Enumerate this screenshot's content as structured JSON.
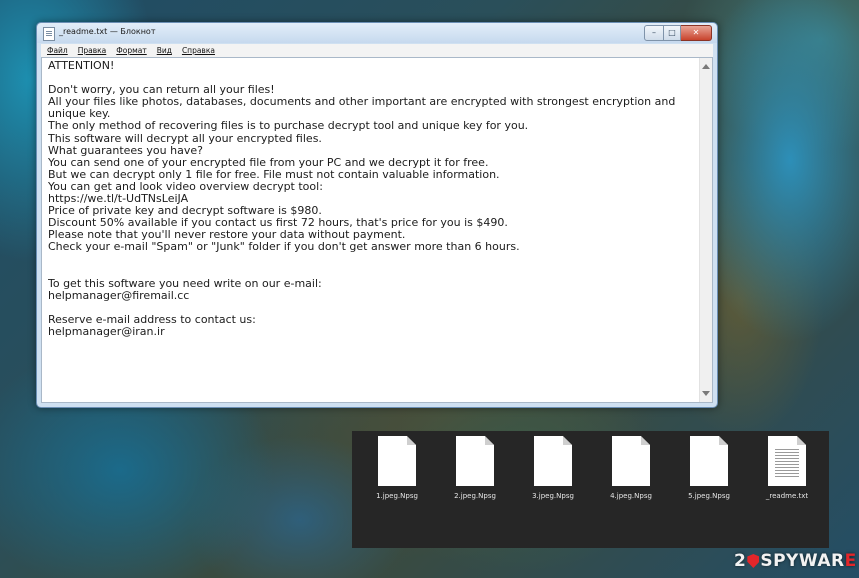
{
  "window": {
    "title": "_readme.txt — Блокнот",
    "buttons": {
      "minimize": "–",
      "maximize": "□",
      "close": "✕"
    }
  },
  "menu": [
    "Файл",
    "Правка",
    "Формат",
    "Вид",
    "Справка"
  ],
  "note": {
    "lines": [
      "ATTENTION!",
      "",
      "Don't worry, you can return all your files!",
      "All your files like photos, databases, documents and other important are encrypted with strongest encryption and unique key.",
      "The only method of recovering files is to purchase decrypt tool and unique key for you.",
      "This software will decrypt all your encrypted files.",
      "What guarantees you have?",
      "You can send one of your encrypted file from your PC and we decrypt it for free.",
      "But we can decrypt only 1 file for free. File must not contain valuable information.",
      "You can get and look video overview decrypt tool:",
      "https://we.tl/t-UdTNsLeiJA",
      "Price of private key and decrypt software is $980.",
      "Discount 50% available if you contact us first 72 hours, that's price for you is $490.",
      "Please note that you'll never restore your data without payment.",
      "Check your e-mail \"Spam\" or \"Junk\" folder if you don't get answer more than 6 hours.",
      "",
      "",
      "To get this software you need write on our e-mail:",
      "helpmanager@firemail.cc",
      "",
      "Reserve e-mail address to contact us:",
      "helpmanager@iran.ir"
    ]
  },
  "files": [
    {
      "name": "1.jpeg.Npsg",
      "icon": "blank-document-icon"
    },
    {
      "name": "2.jpeg.Npsg",
      "icon": "blank-document-icon"
    },
    {
      "name": "3.jpeg.Npsg",
      "icon": "blank-document-icon"
    },
    {
      "name": "4.jpeg.Npsg",
      "icon": "blank-document-icon"
    },
    {
      "name": "5.jpeg.Npsg",
      "icon": "blank-document-icon"
    },
    {
      "name": "_readme.txt",
      "icon": "text-document-icon"
    }
  ],
  "watermark": {
    "prefix": "2",
    "middle": "SPYWAR",
    "suffix": "E"
  }
}
